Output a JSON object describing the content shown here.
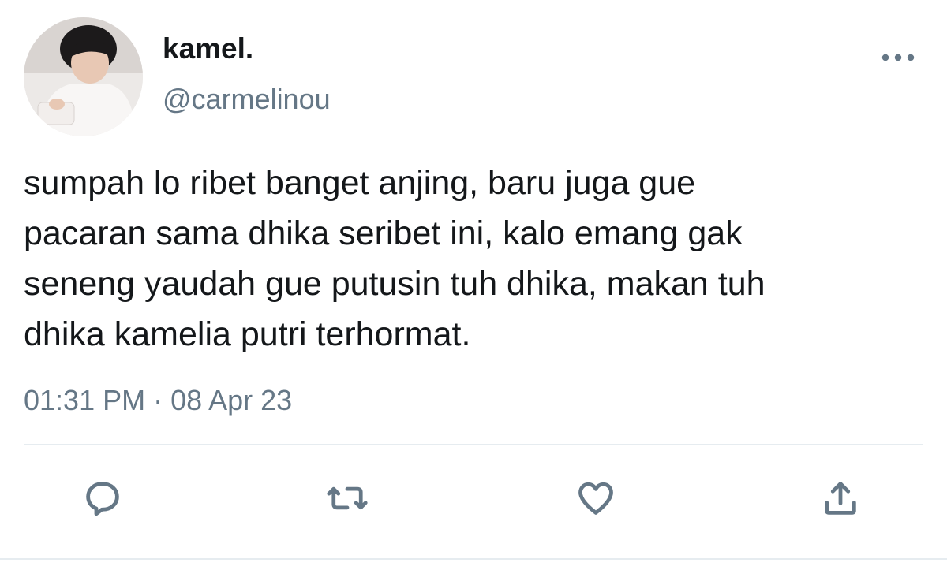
{
  "user": {
    "display_name": "kamel.",
    "handle": "@carmelinou",
    "avatar_icon": "profile-photo"
  },
  "tweet": {
    "text": "sumpah lo ribet banget anjing, baru juga gue\npacaran sama dhika seribet ini, kalo emang gak\nseneng yaudah gue putusin tuh dhika, makan tuh\ndhika kamelia putri terhormat.",
    "timestamp": "01:31 PM · 08 Apr 23"
  },
  "actions": [
    {
      "name": "reply",
      "icon": "speech-bubble-icon"
    },
    {
      "name": "retweet",
      "icon": "retweet-icon"
    },
    {
      "name": "like",
      "icon": "heart-icon"
    },
    {
      "name": "share",
      "icon": "share-icon"
    }
  ],
  "colors": {
    "text_primary": "#14171a",
    "text_secondary": "#657786",
    "divider": "#e6ecf0",
    "background": "#ffffff"
  }
}
